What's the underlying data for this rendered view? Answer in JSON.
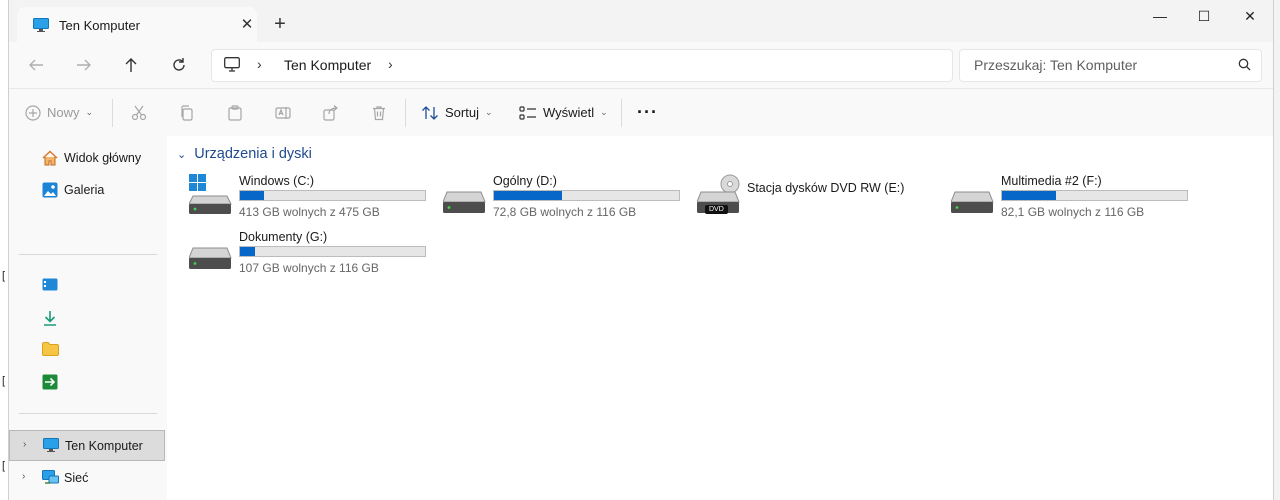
{
  "window": {
    "tab_title": "Ten Komputer",
    "tab_close": "✕",
    "tab_add": "+",
    "minimize": "—",
    "maximize": "☐",
    "close": "✕"
  },
  "nav": {
    "address_segment": "Ten Komputer",
    "search_placeholder": "Przeszukaj: Ten Komputer"
  },
  "commands": {
    "new_label": "Nowy",
    "sort_label": "Sortuj",
    "view_label": "Wyświetl",
    "more_label": "···"
  },
  "sidebar": {
    "home": "Widok główny",
    "gallery": "Galeria",
    "this_pc": "Ten Komputer",
    "network": "Sieć"
  },
  "main": {
    "group_title": "Urządzenia i dyski",
    "drives": [
      {
        "name": "Windows (C:)",
        "free": "413 GB wolnych z 475 GB",
        "used_fraction": 0.13
      },
      {
        "name": "Ogólny (D:)",
        "free": "72,8 GB wolnych z 116 GB",
        "used_fraction": 0.37
      },
      {
        "name": "Stacja dysków DVD RW (E:)",
        "badge": "DVD"
      },
      {
        "name": "Multimedia #2 (F:)",
        "free": "82,1 GB wolnych z 116 GB",
        "used_fraction": 0.29
      },
      {
        "name": "Dokumenty (G:)",
        "free": "107 GB wolnych z 116 GB",
        "used_fraction": 0.08
      }
    ]
  },
  "colors": {
    "accent": "#0667c8",
    "group_title": "#1e4b8f"
  }
}
